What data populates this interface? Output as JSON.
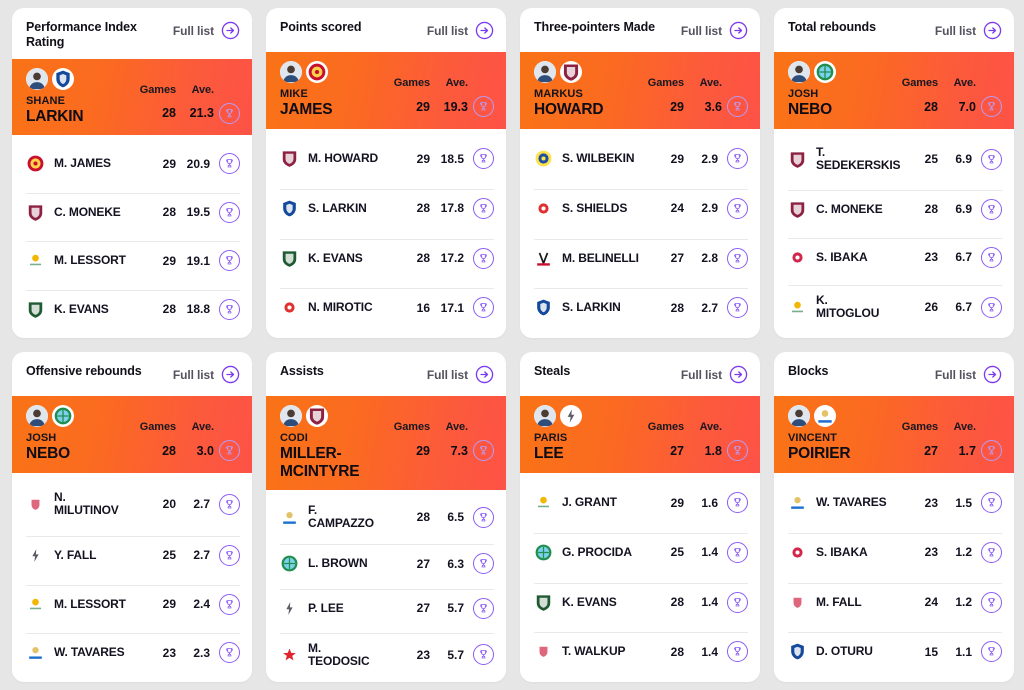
{
  "common": {
    "full_list_label": "Full list",
    "col_games": "Games",
    "col_ave": "Ave.",
    "arrow_icon": "arrow-right-circle-icon",
    "trophy_icon": "trophy-icon"
  },
  "colors": {
    "page_bg": "#e6e6e6",
    "card_bg": "#ffffff",
    "hero_gradient_start": "#F97316",
    "hero_gradient_end": "#FD5247",
    "accent_purple": "#8b5cf6",
    "title_text": "#111018",
    "muted_text": "#55525f",
    "divider": "#e9e9ed"
  },
  "cards": [
    {
      "title": "Performance Index Rating",
      "hero": {
        "first_name": "SHANE",
        "last_name": "LARKIN",
        "games": "28",
        "ave": "21.3",
        "club": "anadolu-efes"
      },
      "rows": [
        {
          "name": "M. JAMES",
          "games": "29",
          "ave": "20.9",
          "club": "monaco"
        },
        {
          "name": "C. MONEKE",
          "games": "28",
          "ave": "19.5",
          "club": "baskonia"
        },
        {
          "name": "M. LESSORT",
          "games": "29",
          "ave": "19.1",
          "club": "panathinaikos"
        },
        {
          "name": "K. EVANS",
          "games": "28",
          "ave": "18.8",
          "club": "zalgiris"
        }
      ]
    },
    {
      "title": "Points scored",
      "hero": {
        "first_name": "MIKE",
        "last_name": "JAMES",
        "games": "29",
        "ave": "19.3",
        "club": "monaco"
      },
      "rows": [
        {
          "name": "M. HOWARD",
          "games": "29",
          "ave": "18.5",
          "club": "baskonia"
        },
        {
          "name": "S. LARKIN",
          "games": "28",
          "ave": "17.8",
          "club": "anadolu-efes"
        },
        {
          "name": "K. EVANS",
          "games": "28",
          "ave": "17.2",
          "club": "zalgiris"
        },
        {
          "name": "N. MIROTIC",
          "games": "16",
          "ave": "17.1",
          "club": "emporio-armani"
        }
      ]
    },
    {
      "title": "Three-pointers Made",
      "hero": {
        "first_name": "MARKUS",
        "last_name": "HOWARD",
        "games": "29",
        "ave": "3.6",
        "club": "baskonia"
      },
      "rows": [
        {
          "name": "S. WILBEKIN",
          "games": "29",
          "ave": "2.9",
          "club": "maccabi"
        },
        {
          "name": "S. SHIELDS",
          "games": "24",
          "ave": "2.9",
          "club": "emporio-armani"
        },
        {
          "name": "M. BELINELLI",
          "games": "27",
          "ave": "2.8",
          "club": "virtus"
        },
        {
          "name": "S. LARKIN",
          "games": "28",
          "ave": "2.7",
          "club": "anadolu-efes"
        }
      ]
    },
    {
      "title": "Total rebounds",
      "hero": {
        "first_name": "JOSH",
        "last_name": "NEBO",
        "games": "28",
        "ave": "7.0",
        "club": "alba"
      },
      "rows": [
        {
          "name": "T.",
          "name2": "SEDEKERSKIS",
          "games": "25",
          "ave": "6.9",
          "club": "baskonia"
        },
        {
          "name": "C. MONEKE",
          "games": "28",
          "ave": "6.9",
          "club": "baskonia"
        },
        {
          "name": "S. IBAKA",
          "games": "23",
          "ave": "6.7",
          "club": "bayern"
        },
        {
          "name": "K.",
          "name2": "MITOGLOU",
          "games": "26",
          "ave": "6.7",
          "club": "panathinaikos"
        }
      ]
    },
    {
      "title": "Offensive rebounds",
      "hero": {
        "first_name": "JOSH",
        "last_name": "NEBO",
        "games": "28",
        "ave": "3.0",
        "club": "alba"
      },
      "rows": [
        {
          "name": "N.",
          "name2": "MILUTINOV",
          "games": "20",
          "ave": "2.7",
          "club": "olympiacos"
        },
        {
          "name": "Y. FALL",
          "games": "25",
          "ave": "2.7",
          "club": "asvel"
        },
        {
          "name": "M. LESSORT",
          "games": "29",
          "ave": "2.4",
          "club": "panathinaikos"
        },
        {
          "name": "W. TAVARES",
          "games": "23",
          "ave": "2.3",
          "club": "real-madrid"
        }
      ]
    },
    {
      "title": "Assists",
      "hero": {
        "first_name": "CODI",
        "last_name": "MILLER-",
        "last_name2": "MCINTYRE",
        "games": "29",
        "ave": "7.3",
        "club": "baskonia"
      },
      "rows": [
        {
          "name": "F.",
          "name2": "CAMPAZZO",
          "games": "28",
          "ave": "6.5",
          "club": "real-madrid"
        },
        {
          "name": "L. BROWN",
          "games": "27",
          "ave": "6.3",
          "club": "alba"
        },
        {
          "name": "P. LEE",
          "games": "27",
          "ave": "5.7",
          "club": "asvel"
        },
        {
          "name": "M.",
          "name2": "TEODOSIC",
          "games": "23",
          "ave": "5.7",
          "club": "crvena-zvezda"
        }
      ]
    },
    {
      "title": "Steals",
      "hero": {
        "first_name": "PARIS",
        "last_name": "LEE",
        "games": "27",
        "ave": "1.8",
        "club": "asvel"
      },
      "rows": [
        {
          "name": "J. GRANT",
          "games": "29",
          "ave": "1.6",
          "club": "panathinaikos"
        },
        {
          "name": "G. PROCIDA",
          "games": "25",
          "ave": "1.4",
          "club": "alba"
        },
        {
          "name": "K. EVANS",
          "games": "28",
          "ave": "1.4",
          "club": "zalgiris"
        },
        {
          "name": "T. WALKUP",
          "games": "28",
          "ave": "1.4",
          "club": "olympiacos"
        }
      ]
    },
    {
      "title": "Blocks",
      "hero": {
        "first_name": "VINCENT",
        "last_name": "POIRIER",
        "games": "27",
        "ave": "1.7",
        "club": "real-madrid"
      },
      "rows": [
        {
          "name": "W. TAVARES",
          "games": "23",
          "ave": "1.5",
          "club": "real-madrid"
        },
        {
          "name": "S. IBAKA",
          "games": "23",
          "ave": "1.2",
          "club": "bayern"
        },
        {
          "name": "M. FALL",
          "games": "24",
          "ave": "1.2",
          "club": "olympiacos"
        },
        {
          "name": "D. OTURU",
          "games": "15",
          "ave": "1.1",
          "club": "anadolu-efes"
        }
      ]
    }
  ]
}
